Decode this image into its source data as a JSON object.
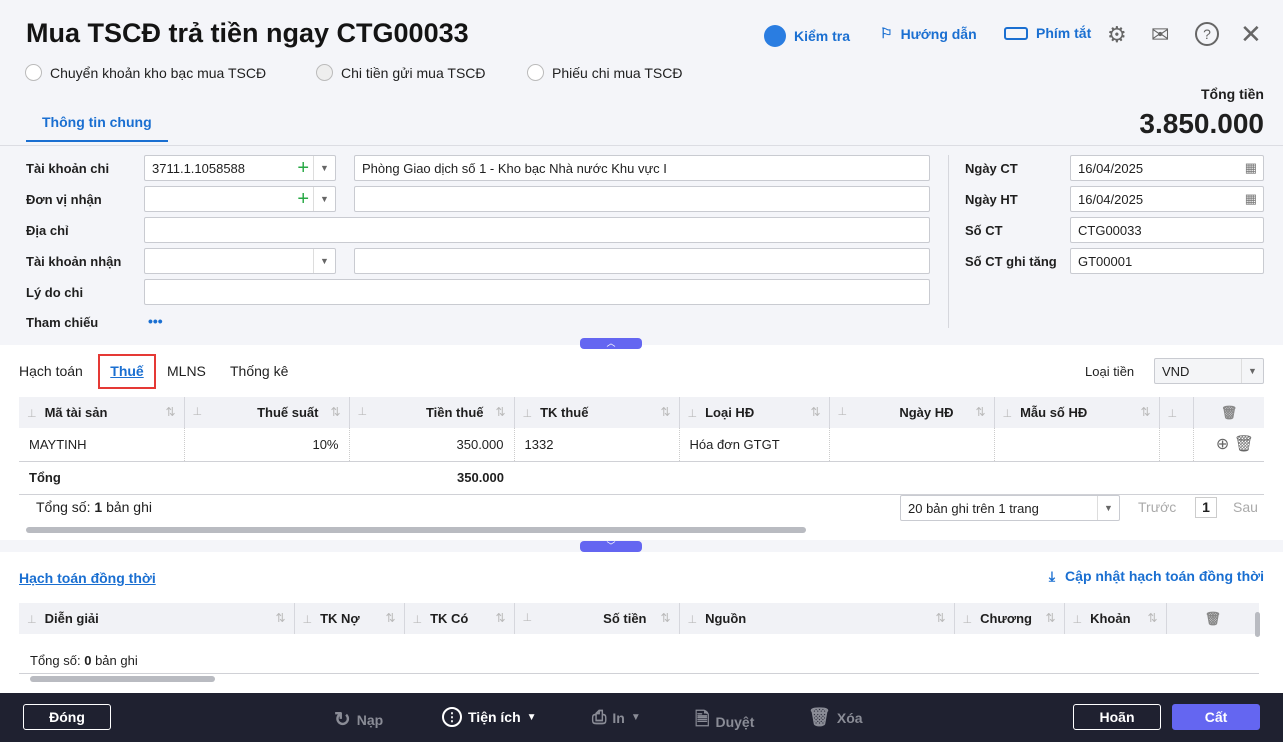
{
  "header": {
    "title": "Mua TSCĐ trả tiền ngay CTG00033",
    "options": [
      {
        "label": "Chuyển khoản kho bạc mua TSCĐ",
        "selected": false
      },
      {
        "label": "Chi tiền gửi mua TSCĐ",
        "selected": true
      },
      {
        "label": "Phiếu chi mua TSCĐ",
        "selected": false
      }
    ],
    "tools": {
      "check": "Kiểm tra",
      "guide": "Hướng dẫn",
      "shortcuts": "Phím tắt"
    },
    "total_label": "Tổng tiền",
    "total_value": "3.850.000",
    "tab": "Thông tin chung"
  },
  "form": {
    "account_label": "Tài khoản chi",
    "account_value": "3711.1.1058588",
    "account_name": "Phòng Giao dịch số 1 - Kho bạc Nhà nước Khu vực I",
    "receiver_label": "Đơn vị nhận",
    "address_label": "Địa chỉ",
    "recv_account_label": "Tài khoản nhận",
    "reason_label": "Lý do chi",
    "ref_label": "Tham chiếu",
    "ref_more": "•••",
    "date_ct_label": "Ngày CT",
    "date_ct": "16/04/2025",
    "date_ht_label": "Ngày HT",
    "date_ht": "16/04/2025",
    "so_ct_label": "Số CT",
    "so_ct": "CTG00033",
    "so_ct_gt_label": "Số CT ghi tăng",
    "so_ct_gt": "GT00001"
  },
  "detail": {
    "tabs": [
      "Hạch toán",
      "Thuế",
      "MLNS",
      "Thống kê"
    ],
    "active_tab": "Thuế",
    "currency_label": "Loại tiền",
    "currency": "VND",
    "columns": [
      "Mã tài sản",
      "Thuế suất",
      "Tiền thuế",
      "TK thuế",
      "Loại HĐ",
      "Ngày HĐ",
      "Mẫu số HĐ"
    ],
    "rows": [
      [
        "MAYTINH",
        "10%",
        "350.000",
        "1332",
        "Hóa đơn GTGT",
        "",
        ""
      ]
    ],
    "total_label": "Tổng",
    "total_tax": "350.000",
    "count_prefix": "Tổng số:",
    "count": "1",
    "count_suffix": "bản ghi",
    "page_size": "20 bản ghi trên 1 trang",
    "prev": "Trước",
    "page": "1",
    "next": "Sau"
  },
  "concurrent": {
    "title": "Hạch toán đồng thời",
    "update": "Cập nhật hạch toán đồng thời",
    "columns": [
      "Diễn giải",
      "TK Nợ",
      "TK Có",
      "Số tiền",
      "Nguồn",
      "Chương",
      "Khoản"
    ],
    "count_prefix": "Tổng số:",
    "count": "0",
    "count_suffix": "bản ghi"
  },
  "footer": {
    "close": "Đóng",
    "reload": "Nạp",
    "utilities": "Tiện ích",
    "print": "In",
    "approve": "Duyệt",
    "delete": "Xóa",
    "cancel": "Hoãn",
    "save": "Cất"
  },
  "colors": {
    "accent": "#1a6fd1",
    "primary": "#6466f1",
    "footer_bg": "#1f2130"
  }
}
